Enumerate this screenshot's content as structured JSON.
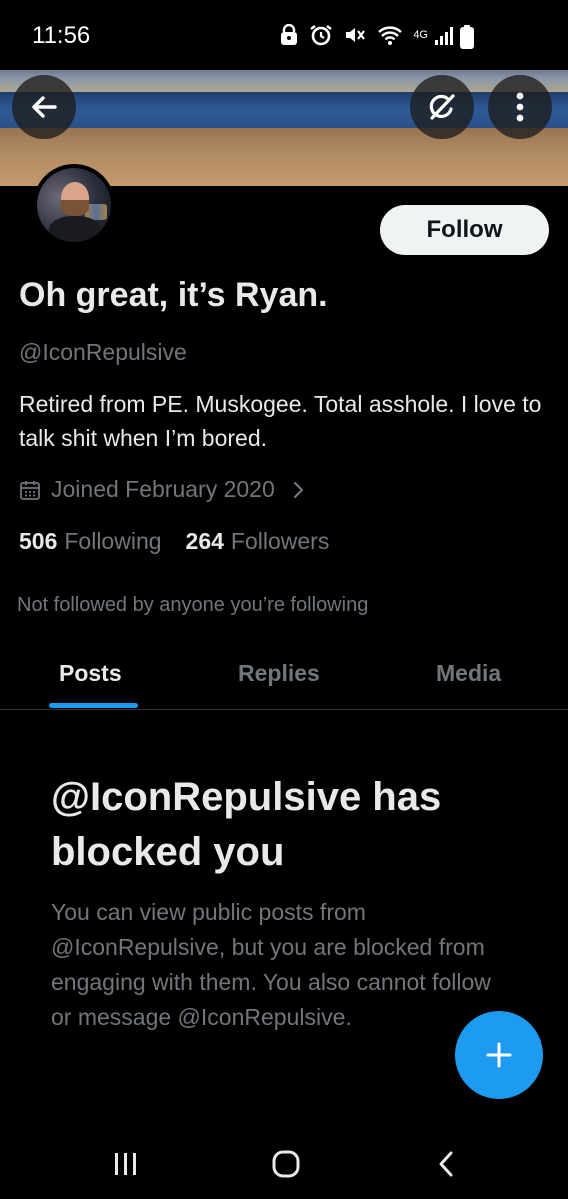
{
  "status_bar": {
    "time": "11:56",
    "network": "4G"
  },
  "profile": {
    "display_name": "Oh great, it’s Ryan.",
    "handle": "@IconRepulsive",
    "bio": "Retired from PE. Muskogee. Total asshole. I love to talk shit when I’m bored.",
    "joined": "Joined February 2020",
    "following_count": "506",
    "following_label": "Following",
    "followers_count": "264",
    "followers_label": "Followers",
    "not_followed_text": "Not followed by anyone you’re following",
    "follow_button_label": "Follow"
  },
  "tabs": [
    {
      "label": "Posts",
      "active": true
    },
    {
      "label": "Replies",
      "active": false
    },
    {
      "label": "Media",
      "active": false
    }
  ],
  "blocked_notice": {
    "title": "@IconRepulsive has blocked you",
    "body": "You can view public posts from @IconRepulsive, but you are blocked from engaging with them. You also cannot follow or message @IconRepulsive."
  },
  "icons": {
    "back": "back-arrow-icon",
    "grok": "grok-icon",
    "more": "more-vertical-icon",
    "calendar": "calendar-icon",
    "compose": "plus-icon",
    "nav_recents": "recents-icon",
    "nav_home": "home-icon",
    "nav_back": "nav-back-icon"
  },
  "colors": {
    "accent": "#1d9bf0",
    "background": "#000000",
    "text_primary": "#e7e9ea",
    "text_secondary": "#71767b"
  }
}
